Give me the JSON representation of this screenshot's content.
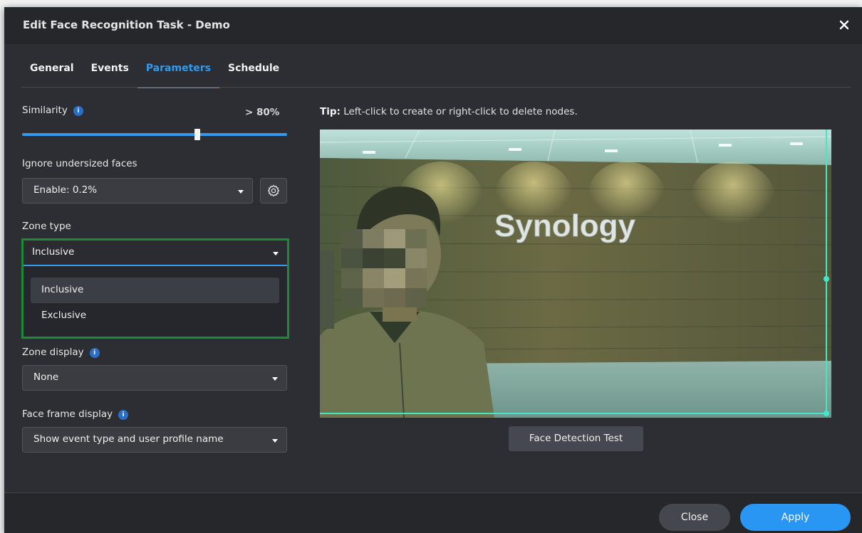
{
  "dialog": {
    "title": "Edit Face Recognition Task - Demo"
  },
  "tabs": [
    {
      "label": "General"
    },
    {
      "label": "Events"
    },
    {
      "label": "Parameters"
    },
    {
      "label": "Schedule"
    }
  ],
  "similarity": {
    "label": "Similarity",
    "value_text": "> 80%",
    "slider_fraction": 0.66
  },
  "ignore_faces": {
    "label": "Ignore undersized faces",
    "value": "Enable: 0.2%"
  },
  "zone_type": {
    "label": "Zone type",
    "value": "Inclusive",
    "options": [
      {
        "label": "Inclusive"
      },
      {
        "label": "Exclusive"
      }
    ]
  },
  "zone_display": {
    "label": "Zone display",
    "value": "None"
  },
  "face_frame": {
    "label": "Face frame display",
    "value": "Show event type and user profile name"
  },
  "preview": {
    "tip_bold": "Tip:",
    "tip_text": "Left-click to create or right-click to delete nodes.",
    "sign_text": "Synology",
    "detect_button": "Face Detection Test"
  },
  "footer": {
    "close_label": "Close",
    "apply_label": "Apply"
  },
  "colors": {
    "accent": "#2f9bf2",
    "highlight_border": "#1c8a37",
    "zone_line": "#3ee8c8"
  }
}
